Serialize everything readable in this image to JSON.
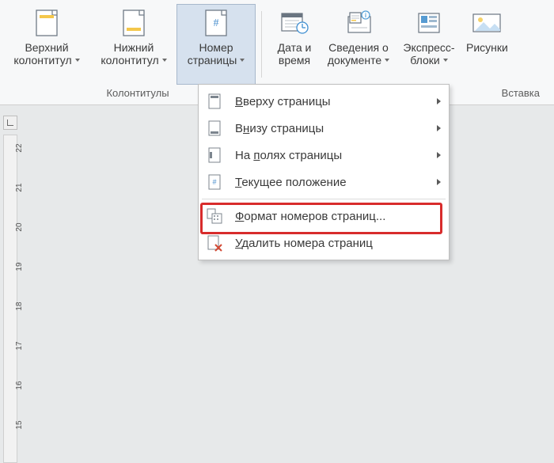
{
  "ribbon": {
    "group1": {
      "header_top": {
        "l1": "Верхний",
        "l2": "колонтитул"
      },
      "footer_bottom": {
        "l1": "Нижний",
        "l2": "колонтитул"
      },
      "page_number": {
        "l1": "Номер",
        "l2": "страницы"
      },
      "label": "Колонтитулы"
    },
    "group2": {
      "date_time": {
        "l1": "Дата и",
        "l2": "время"
      },
      "doc_info": {
        "l1": "Сведения о",
        "l2": "документе"
      },
      "quick_parts": {
        "l1": "Экспресс-",
        "l2": "блоки"
      },
      "pictures": {
        "l1": "Рисунки",
        "l2": ""
      },
      "label": "Вставка"
    }
  },
  "menu": {
    "top_of_page": "Вверху страницы",
    "bottom_of_page": "Внизу страницы",
    "page_margins": "На полях страницы",
    "current_position": "Текущее положение",
    "format_numbers": "Формат номеров страниц...",
    "remove_numbers": "Удалить номера страниц"
  },
  "ruler": {
    "ticks": [
      "22",
      "21",
      "20",
      "19",
      "18",
      "17",
      "16",
      "15"
    ]
  }
}
